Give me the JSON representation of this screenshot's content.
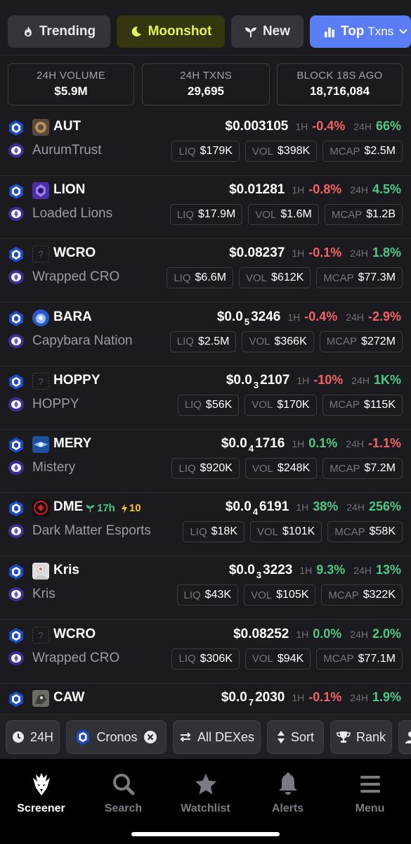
{
  "tabs": [
    {
      "label": "Trending",
      "icon": "flame-icon"
    },
    {
      "label": "Moonshot",
      "icon": "moon-icon"
    },
    {
      "label": "New",
      "icon": "sprout-icon"
    },
    {
      "label": "Top",
      "sublabel": "Txns",
      "icon": "bar-chart-icon"
    }
  ],
  "stats": {
    "volume": {
      "label": "24H VOLUME",
      "value": "$5.9M"
    },
    "txns": {
      "label": "24H TXNS",
      "value": "29,695"
    },
    "block": {
      "label": "BLOCK 18S AGO",
      "value": "18,716,084"
    }
  },
  "labels": {
    "h1": "1H",
    "h24": "24H",
    "liq": "LIQ",
    "vol": "VOL",
    "mcap": "MCAP"
  },
  "colors": {
    "accent": "#5a7cf4",
    "positive": "#4ec883",
    "negative": "#f16363",
    "moonshot": "#e6f25a"
  },
  "pairs": [
    {
      "symbol": "AUT",
      "name": "AurumTrust",
      "price_pre": "$0.003105",
      "price_sub": "",
      "price_post": "",
      "h1": "-0.4%",
      "h1_dir": "neg",
      "h24": "66%",
      "h24_dir": "pos",
      "liq": "$179K",
      "vol": "$398K",
      "mcap": "$2.5M",
      "icon": "aut-token-icon"
    },
    {
      "symbol": "LION",
      "name": "Loaded Lions",
      "price_pre": "$0.01281",
      "price_sub": "",
      "price_post": "",
      "h1": "-0.8%",
      "h1_dir": "neg",
      "h24": "4.5%",
      "h24_dir": "pos",
      "liq": "$17.9M",
      "vol": "$1.6M",
      "mcap": "$1.2B",
      "icon": "lion-token-icon"
    },
    {
      "symbol": "WCRO",
      "name": "Wrapped CRO",
      "price_pre": "$0.08237",
      "price_sub": "",
      "price_post": "",
      "h1": "-0.1%",
      "h1_dir": "neg",
      "h24": "1.8%",
      "h24_dir": "pos",
      "liq": "$6.6M",
      "vol": "$612K",
      "mcap": "$77.3M",
      "icon": "unknown-token-icon"
    },
    {
      "symbol": "BARA",
      "name": "Capybara Nation",
      "price_pre": "$0.0",
      "price_sub": "5",
      "price_post": "3246",
      "h1": "-0.4%",
      "h1_dir": "neg",
      "h24": "-2.9%",
      "h24_dir": "neg",
      "liq": "$2.5M",
      "vol": "$366K",
      "mcap": "$272M",
      "icon": "bara-token-icon"
    },
    {
      "symbol": "HOPPY",
      "name": "HOPPY",
      "price_pre": "$0.0",
      "price_sub": "3",
      "price_post": "2107",
      "h1": "-10%",
      "h1_dir": "neg",
      "h24": "1K%",
      "h24_dir": "pos",
      "liq": "$56K",
      "vol": "$170K",
      "mcap": "$115K",
      "icon": "unknown-token-icon"
    },
    {
      "symbol": "MERY",
      "name": "Mistery",
      "price_pre": "$0.0",
      "price_sub": "4",
      "price_post": "1716",
      "h1": "0.1%",
      "h1_dir": "pos",
      "h24": "-1.1%",
      "h24_dir": "neg",
      "liq": "$920K",
      "vol": "$248K",
      "mcap": "$7.2M",
      "icon": "mery-token-icon"
    },
    {
      "symbol": "DME",
      "name": "Dark Matter Esports",
      "price_pre": "$0.0",
      "price_sub": "4",
      "price_post": "6191",
      "h1": "38%",
      "h1_dir": "pos",
      "h24": "256%",
      "h24_dir": "pos",
      "liq": "$18K",
      "vol": "$101K",
      "mcap": "$58K",
      "icon": "dme-token-icon",
      "age": "17h",
      "boost": "10"
    },
    {
      "symbol": "Kris",
      "name": "Kris",
      "price_pre": "$0.0",
      "price_sub": "3",
      "price_post": "3223",
      "h1": "9.3%",
      "h1_dir": "pos",
      "h24": "13%",
      "h24_dir": "pos",
      "liq": "$43K",
      "vol": "$105K",
      "mcap": "$322K",
      "icon": "kris-token-icon"
    },
    {
      "symbol": "WCRO",
      "name": "Wrapped CRO",
      "price_pre": "$0.08252",
      "price_sub": "",
      "price_post": "",
      "h1": "0.0%",
      "h1_dir": "pos",
      "h24": "2.0%",
      "h24_dir": "pos",
      "liq": "$306K",
      "vol": "$94K",
      "mcap": "$77.1M",
      "icon": "unknown-token-icon"
    },
    {
      "symbol": "CAW",
      "name": "",
      "price_pre": "$0.0",
      "price_sub": "7",
      "price_post": "2030",
      "h1": "-0.1%",
      "h1_dir": "neg",
      "h24": "1.9%",
      "h24_dir": "pos",
      "liq": "",
      "vol": "",
      "mcap": "",
      "icon": "caw-token-icon"
    }
  ],
  "filters": {
    "timeframe": "24H",
    "chain": "Cronos",
    "dexes": "All DEXes",
    "sort": "Sort",
    "rank": "Rank"
  },
  "nav": [
    {
      "label": "Screener",
      "icon": "eagle-icon",
      "active": true
    },
    {
      "label": "Search",
      "icon": "search-icon",
      "active": false
    },
    {
      "label": "Watchlist",
      "icon": "star-icon",
      "active": false
    },
    {
      "label": "Alerts",
      "icon": "bell-icon",
      "active": false
    },
    {
      "label": "Menu",
      "icon": "menu-icon",
      "active": false
    }
  ]
}
